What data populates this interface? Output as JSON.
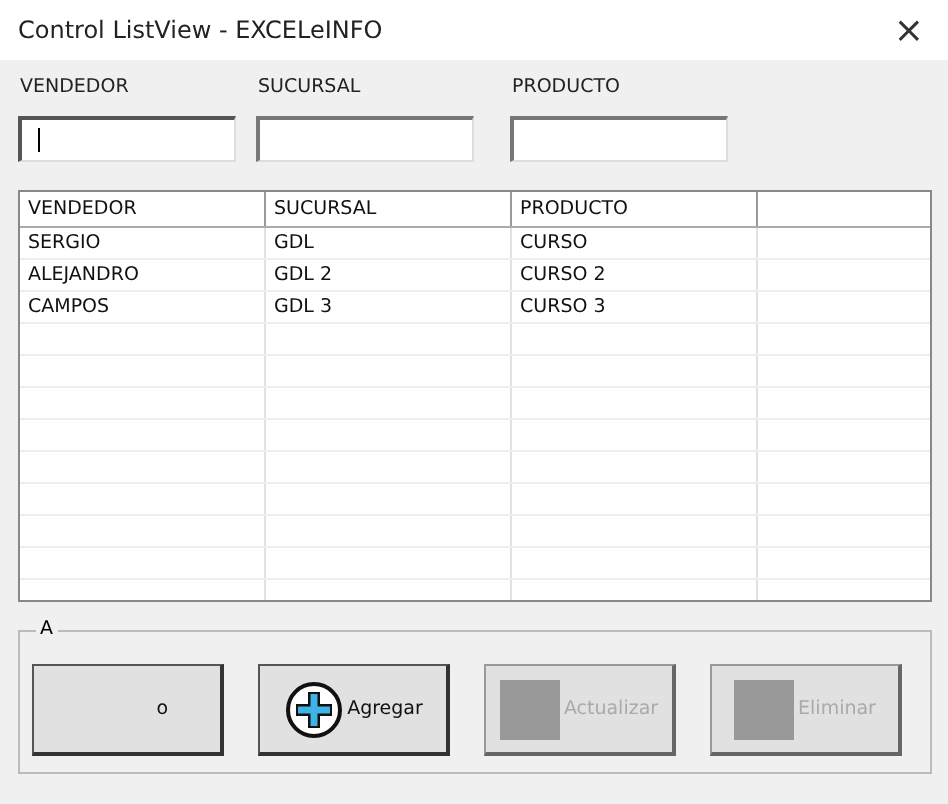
{
  "window": {
    "title": "Control ListView - EXCELeINFO",
    "close": "×"
  },
  "fields": [
    {
      "label": "VENDEDOR",
      "focused": true
    },
    {
      "label": "SUCURSAL",
      "focused": false
    },
    {
      "label": "PRODUCTO",
      "focused": false
    }
  ],
  "table": {
    "columns": [
      "VENDEDOR",
      "SUCURSAL",
      "PRODUCTO"
    ],
    "rows": [
      [
        "SERGIO",
        "GDL",
        "CURSO"
      ],
      [
        "ALEJANDRO",
        "GDL 2",
        "CURSO 2"
      ],
      [
        "CAMPOS",
        "GDL 3",
        "CURSO 3"
      ]
    ]
  },
  "group": {
    "caption": "A"
  },
  "buttons": [
    {
      "label": "o",
      "kind": "plain",
      "disabled": false
    },
    {
      "label": "Agregar",
      "kind": "plus",
      "disabled": false
    },
    {
      "label": "Actualizar",
      "kind": "square",
      "disabled": true
    },
    {
      "label": "Eliminar",
      "kind": "square",
      "disabled": true
    }
  ]
}
